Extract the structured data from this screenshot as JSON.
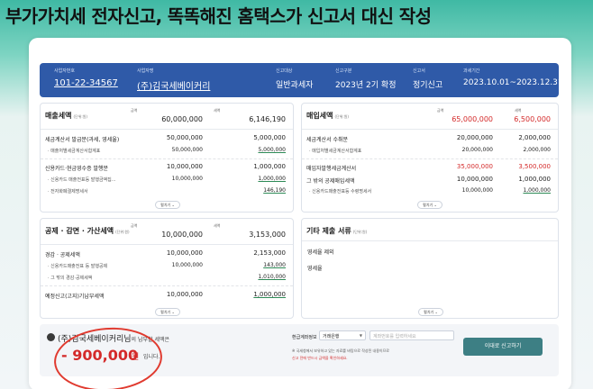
{
  "headline": "부가가치세 전자신고, 똑똑해진 홈택스가 신고서 대신 작성",
  "info_bar": {
    "bizno_label": "사업자번호",
    "bizno": "101-22-34567",
    "company_label": "사업자명",
    "company": "(주)김국세베이커리",
    "target_label": "신고대상",
    "target": "일반과세자",
    "type_label": "신고구분",
    "type": "2023년 2기 확정",
    "kind_label": "신고서",
    "kind": "정기신고",
    "period_label": "과세기간",
    "period": "2023.10.01~2023.12.31"
  },
  "sales": {
    "title": "매출세액",
    "unit": "(단위:원)",
    "col1": "금액",
    "col2": "세액",
    "total_amount": "60,000,000",
    "total_tax": "6,146,190",
    "rows": [
      {
        "label": "세금계산서 발급분(과세, 영세율)",
        "amount": "50,000,000",
        "tax": "5,000,000"
      },
      {
        "label": "· 매출처별세금계산서합계표",
        "amount": "50,000,000",
        "tax": "5,000,000"
      },
      {
        "label": "신용카드·현금영수증 발행분",
        "amount": "10,000,000",
        "tax": "1,000,000"
      },
      {
        "label": "· 신용카드 매출전표등 발행금액집...",
        "amount": "10,000,000",
        "tax": "1,000,000"
      },
      {
        "label": "· 전자화폐결제명세서",
        "amount": "",
        "tax": "146,190"
      }
    ],
    "toggle": "펼치기 ⌄"
  },
  "purchase": {
    "title": "매입세액",
    "unit": "(단위:원)",
    "col1": "금액",
    "col2": "세액",
    "total_amount": "65,000,000",
    "total_tax": "6,500,000",
    "rows": [
      {
        "label": "세금계산서 수취분",
        "amount": "20,000,000",
        "tax": "2,000,000"
      },
      {
        "label": "· 매입처별세금계산서합계표",
        "amount": "20,000,000",
        "tax": "2,000,000"
      },
      {
        "label": "매입자발행세금계산서",
        "amount": "35,000,000",
        "tax": "3,500,000"
      },
      {
        "label": "그 밖의 공제매입세액",
        "amount": "10,000,000",
        "tax": "1,000,000"
      },
      {
        "label": "· 신용카드매출전표등 수령명세서",
        "amount": "10,000,000",
        "tax": "1,000,000"
      }
    ],
    "toggle": "펼치기 ⌄"
  },
  "deduction": {
    "title": "공제 · 감면 · 가산세액",
    "unit": "(단위:원)",
    "col1": "금액",
    "col2": "세액",
    "total_amount": "10,000,000",
    "total_tax": "3,153,000",
    "rows": [
      {
        "label": "경감 · 공제세액",
        "amount": "10,000,000",
        "tax": "2,153,000"
      },
      {
        "label": "· 신용카드매출전표 등 발행공제",
        "amount": "10,000,000",
        "tax": "143,000"
      },
      {
        "label": "· 그 밖의 경감·공제세액",
        "amount": "",
        "tax": "1,010,000"
      },
      {
        "label": "예정신고(고지)기납부세액",
        "amount": "10,000,000",
        "tax": "1,000,000"
      }
    ],
    "toggle": "펼치기 ⌄"
  },
  "other": {
    "title": "기타 제출 서류",
    "unit": "(단위:원)",
    "items": [
      "영세율 제외",
      "영세율"
    ],
    "toggle": "펼치기 ⌄"
  },
  "footer": {
    "name": "(주)김국세베이커리님",
    "name_tail": "의 납부할 세액은",
    "amount": "- 900,000",
    "amount_unit": "원",
    "amount_tail": "입니다.",
    "refund_label": "환급계좌정보",
    "bank": "거래은행",
    "account_placeholder": "계좌번호를 입력하세요",
    "note1": "※ 국세청에서 보유하고 있는 자료를 바탕으로 작성된 내용이므로",
    "note2": "신고 전에 반드시 금액을 확인하세요.",
    "submit": "이대로 신고하기"
  },
  "colors": {
    "header_bar": "#2f5aa8",
    "accent_red": "#d42a2a",
    "submit": "#3d7f84"
  }
}
